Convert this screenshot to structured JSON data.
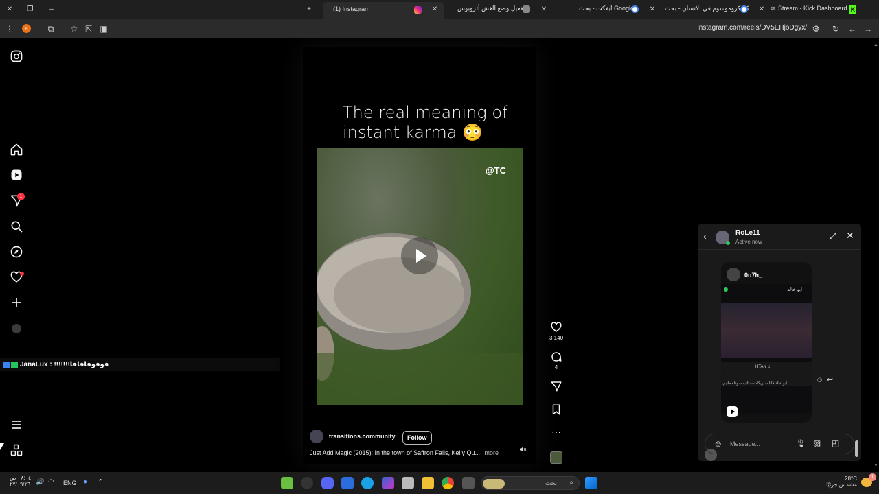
{
  "browser": {
    "tabs": [
      {
        "label": "(1) Instagram",
        "active": true
      },
      {
        "label": "تفعيل وضع الغش أتروبوس",
        "active": false
      },
      {
        "label": "ايفكت - بحث Google",
        "active": false
      },
      {
        "label": "كم كروموسوم في الانسان - بحث",
        "active": false
      },
      {
        "label": "Stream - Kick Dashboard",
        "active": false
      }
    ],
    "url": "instagram.com/reels/DV5EHjoDgyx/"
  },
  "sidebar": {
    "notification_count": "1"
  },
  "stream_overlay": {
    "text": "JanaLux : !!!!!!!قوقوقاقاقا"
  },
  "reel": {
    "caption_line1": "The real meaning of",
    "caption_line2": "instant karma 😳",
    "watermark": "@TC",
    "username": "transitions.community",
    "follow_label": "Follow",
    "description": "Just Add Magic (2015): In the town of Saffron Falls, Kelly Qu...",
    "more_label": "more",
    "likes": "3,140",
    "comments": "4"
  },
  "chat": {
    "name": "RoLe11",
    "status": "Active now",
    "shared_user": "0u7h_",
    "shared_inner_name": "ابو خالد",
    "shared_inner_text1": "ابو خالد قلنا ستريكات شالتبه سوداء مانبي",
    "shared_inner_song": "HTAN ♫",
    "message_placeholder": "Message..."
  },
  "taskbar": {
    "time": "٠٨:٠٤ ص",
    "date": "٢٧/٠٩/٢٦",
    "lang": "ENG",
    "search_placeholder": "بحث",
    "temperature": "28°C",
    "weather": "مشمس جزئيًا",
    "weather_badge": "1"
  }
}
